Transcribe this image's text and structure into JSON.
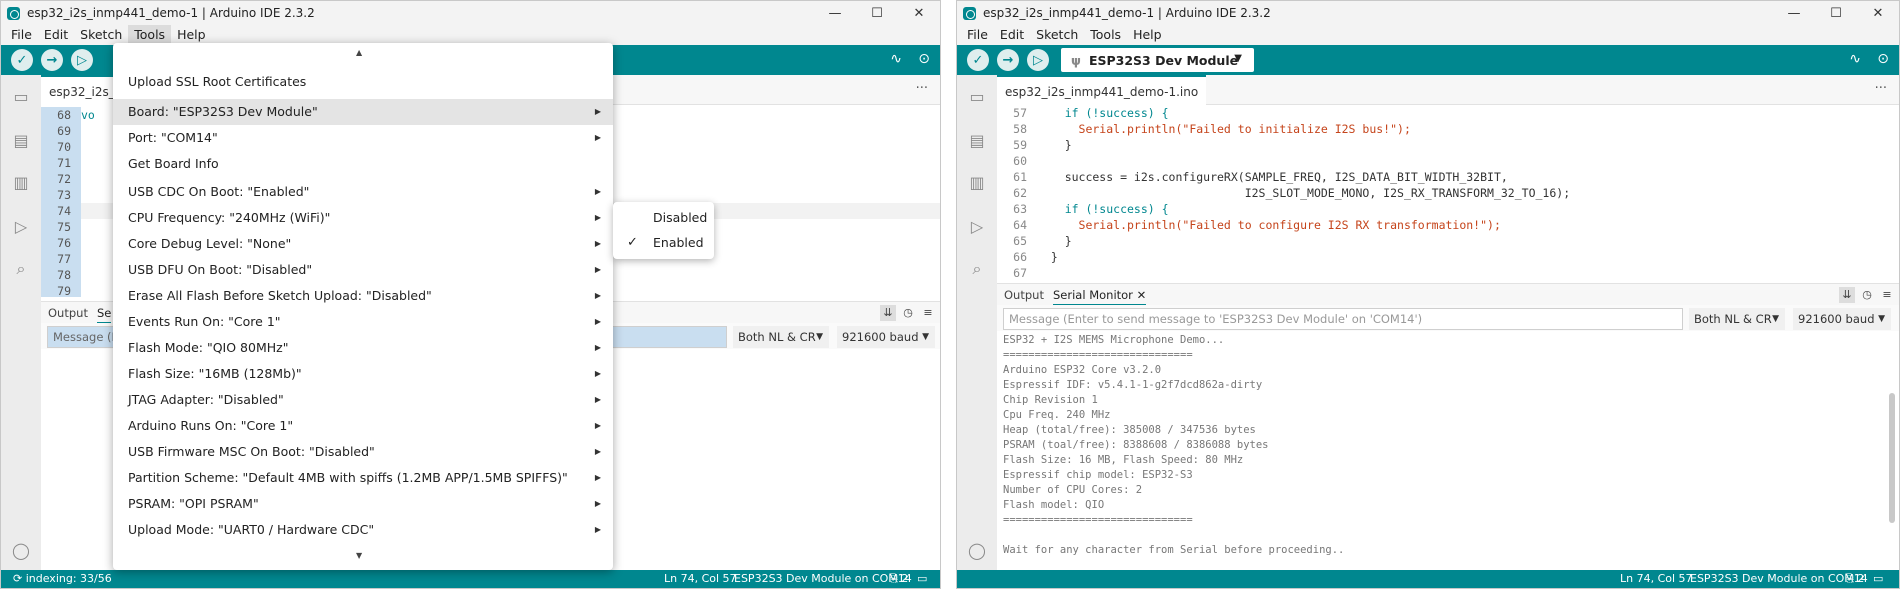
{
  "left": {
    "title": "esp32_i2s_inmp441_demo-1 | Arduino IDE 2.3.2",
    "menus": [
      "File",
      "Edit",
      "Sketch",
      "Tools",
      "Help"
    ],
    "file_tab": "esp32_i2s_in",
    "line_numbers": [
      "68",
      "69",
      "70",
      "71",
      "72",
      "73",
      "74",
      "75",
      "76",
      "77",
      "78",
      "79"
    ],
    "code_fragment": "vo",
    "tab_output": "Output",
    "tab_serial": "Se",
    "message_placeholder": "Message (En",
    "line_ending": "Both NL & CR",
    "baud": "921600 baud",
    "status_left": "indexing: 33/56",
    "status_pos": "Ln 74, Col 57",
    "status_board": "ESP32S3 Dev Module on COM14",
    "status_notif": "2"
  },
  "tools_menu": {
    "items": [
      "Upload SSL Root Certificates",
      "Board: \"ESP32S3 Dev Module\"",
      "Port: \"COM14\"",
      "Get Board Info",
      "USB CDC On Boot: \"Enabled\"",
      "CPU Frequency: \"240MHz (WiFi)\"",
      "Core Debug Level: \"None\"",
      "USB DFU On Boot: \"Disabled\"",
      "Erase All Flash Before Sketch Upload: \"Disabled\"",
      "Events Run On: \"Core 1\"",
      "Flash Mode: \"QIO 80MHz\"",
      "Flash Size: \"16MB (128Mb)\"",
      "JTAG Adapter: \"Disabled\"",
      "Arduino Runs On: \"Core 1\"",
      "USB Firmware MSC On Boot: \"Disabled\"",
      "Partition Scheme: \"Default 4MB with spiffs (1.2MB APP/1.5MB SPIFFS)\"",
      "PSRAM: \"OPI PSRAM\"",
      "Upload Mode: \"UART0 / Hardware CDC\""
    ],
    "submenu": [
      "Disabled",
      "Enabled"
    ]
  },
  "right": {
    "title": "esp32_i2s_inmp441_demo-1 | Arduino IDE 2.3.2",
    "menus": [
      "File",
      "Edit",
      "Sketch",
      "Tools",
      "Help"
    ],
    "board": "ESP32S3 Dev Module",
    "file_tab": "esp32_i2s_inmp441_demo-1.ino",
    "code": [
      {
        "n": "57",
        "t": "    if (!success) {"
      },
      {
        "n": "58",
        "t": "      Serial.println(\"Failed to initialize I2S bus!\");"
      },
      {
        "n": "59",
        "t": "    }"
      },
      {
        "n": "60",
        "t": ""
      },
      {
        "n": "61",
        "t": "    success = i2s.configureRX(SAMPLE_FREQ, I2S_DATA_BIT_WIDTH_32BIT,"
      },
      {
        "n": "62",
        "t": "                              I2S_SLOT_MODE_MONO, I2S_RX_TRANSFORM_32_TO_16);"
      },
      {
        "n": "63",
        "t": "    if (!success) {"
      },
      {
        "n": "64",
        "t": "      Serial.println(\"Failed to configure I2S RX transformation!\");"
      },
      {
        "n": "65",
        "t": "    }"
      },
      {
        "n": "66",
        "t": "  }"
      },
      {
        "n": "67",
        "t": ""
      }
    ],
    "tab_output": "Output",
    "tab_serial": "Serial Monitor",
    "message_placeholder": "Message (Enter to send message to 'ESP32S3 Dev Module' on 'COM14')",
    "line_ending": "Both NL & CR",
    "baud": "921600 baud",
    "serial_lines": [
      "ESP32 + I2S MEMS Microphone Demo...",
      "==============================",
      "Arduino ESP32 Core v3.2.0",
      "Espressif IDF: v5.4.1-1-g2f7dcd862a-dirty",
      "Chip Revision 1",
      "Cpu Freq. 240 MHz",
      "Heap (total/free): 385008 / 347536 bytes",
      "PSRAM (toal/free): 8388608 / 8386088 bytes",
      "Flash Size: 16 MB, Flash Speed: 80 MHz",
      "Espressif chip model: ESP32-S3",
      "Number of CPU Cores: 2",
      "Flash model: QIO",
      "==============================",
      "",
      "Wait for any character from Serial before proceeding.."
    ],
    "status_pos": "Ln 74, Col 57",
    "status_board": "ESP32S3 Dev Module on COM14",
    "status_notif": "2"
  }
}
